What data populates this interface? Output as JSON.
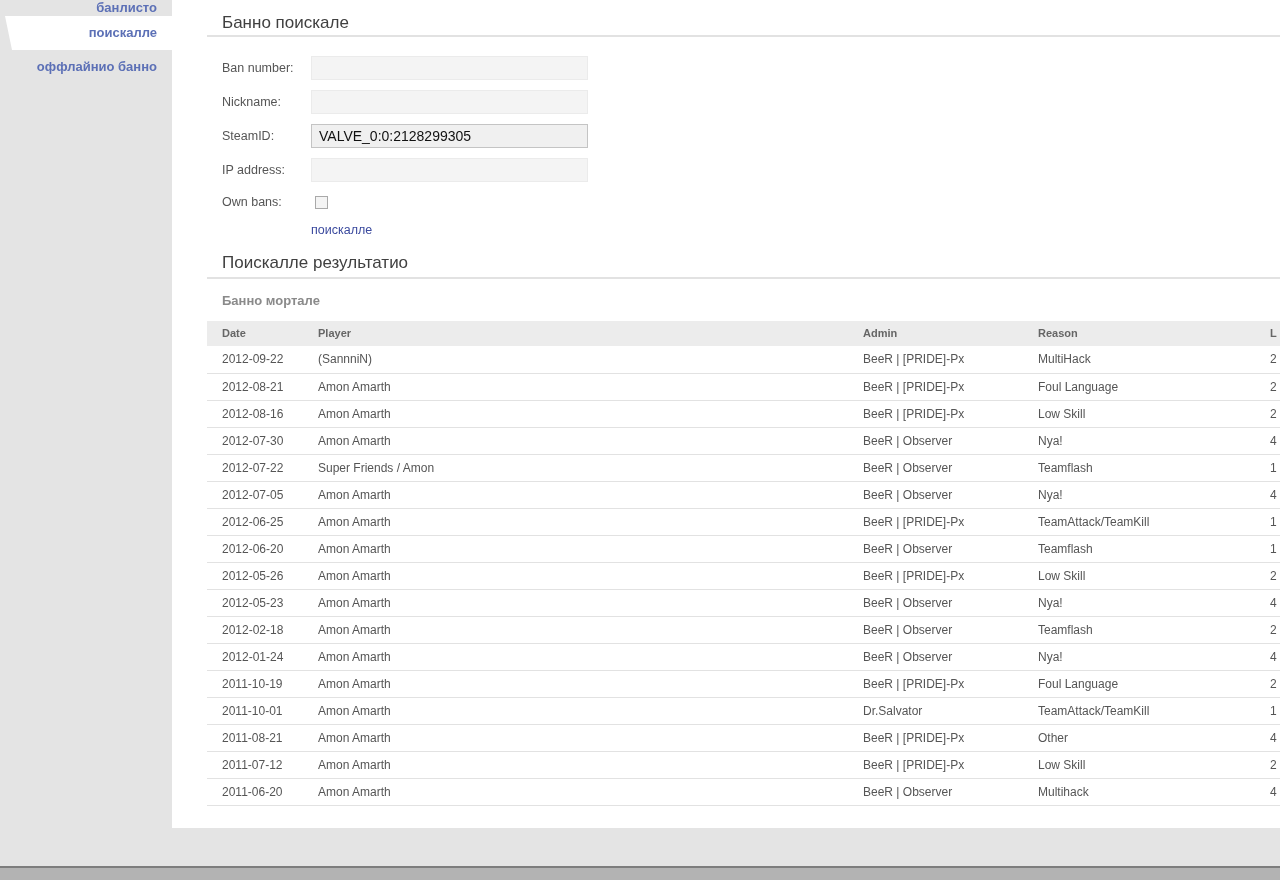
{
  "sidebar": {
    "items": [
      {
        "label": "банлисто",
        "selected": false
      },
      {
        "label": "поискалле",
        "selected": true
      },
      {
        "label": "оффлайнио банно",
        "selected": false
      }
    ]
  },
  "search_form": {
    "title": "Банно поискале",
    "fields": [
      {
        "kind": "text",
        "label": "Ban number:",
        "focused": false
      },
      {
        "kind": "text",
        "label": "Nickname:",
        "focused": false
      },
      {
        "kind": "text",
        "label": "SteamID:",
        "value": "VALVE_0:0:2128299305",
        "focused": true
      },
      {
        "kind": "text",
        "label": "IP address:",
        "focused": false
      },
      {
        "kind": "checkbox",
        "label": "Own bans:",
        "checked": false
      }
    ],
    "submit_link": "поискалле"
  },
  "results": {
    "title": "Поискалле результатио",
    "subtitle": "Банно мортале",
    "table": {
      "columns": [
        "Date",
        "Player",
        "Admin",
        "Reason",
        "L"
      ],
      "rows": [
        [
          "2012-09-22",
          "(SannniN)",
          "BeeR | [PRIDE]-Px",
          "MultiHack",
          "2"
        ],
        [
          "2012-08-21",
          "Amon Amarth",
          "BeeR | [PRIDE]-Px",
          "Foul Language",
          "2"
        ],
        [
          "2012-08-16",
          "Amon Amarth",
          "BeeR | [PRIDE]-Px",
          "Low Skill",
          "2"
        ],
        [
          "2012-07-30",
          "Amon Amarth",
          "BeeR | Observer",
          "Nya!",
          "4"
        ],
        [
          "2012-07-22",
          "Super Friends / Amon",
          "BeeR | Observer",
          "Teamflash",
          "1"
        ],
        [
          "2012-07-05",
          "Amon Amarth",
          "BeeR | Observer",
          "Nya!",
          "4"
        ],
        [
          "2012-06-25",
          "Amon Amarth",
          "BeeR | [PRIDE]-Px",
          "TeamAttack/TeamKill",
          "1"
        ],
        [
          "2012-06-20",
          "Amon Amarth",
          "BeeR | Observer",
          "Teamflash",
          "1"
        ],
        [
          "2012-05-26",
          "Amon Amarth",
          "BeeR | [PRIDE]-Px",
          "Low Skill",
          "2"
        ],
        [
          "2012-05-23",
          "Amon Amarth",
          "BeeR | Observer",
          "Nya!",
          "4"
        ],
        [
          "2012-02-18",
          "Amon Amarth",
          "BeeR | Observer",
          "Teamflash",
          "2"
        ],
        [
          "2012-01-24",
          "Amon Amarth",
          "BeeR | Observer",
          "Nya!",
          "4"
        ],
        [
          "2011-10-19",
          "Amon Amarth",
          "BeeR | [PRIDE]-Px",
          "Foul Language",
          "2"
        ],
        [
          "2011-10-01",
          "Amon Amarth",
          "Dr.Salvator",
          "TeamAttack/TeamKill",
          "1"
        ],
        [
          "2011-08-21",
          "Amon Amarth",
          "BeeR | [PRIDE]-Px",
          "Other",
          "4"
        ],
        [
          "2011-07-12",
          "Amon Amarth",
          "BeeR | [PRIDE]-Px",
          "Low Skill",
          "2"
        ],
        [
          "2011-06-20",
          "Amon Amarth",
          "BeeR | Observer",
          "Multihack",
          "4"
        ]
      ]
    }
  }
}
